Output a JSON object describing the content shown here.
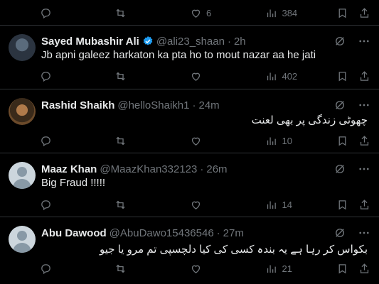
{
  "prev_tweet": {
    "likes": "6",
    "views": "384"
  },
  "tweets": [
    {
      "name": "Sayed Mubashir Ali",
      "handle": "@ali23_shaan",
      "sep": "·",
      "time": "2h",
      "text": "Jb apni galeez harkaton ka pta ho to mout nazar aa he jati",
      "views": "402",
      "verified": true
    },
    {
      "name": "Rashid Shaikh",
      "handle": "@helloShaikh1",
      "sep": "·",
      "time": "24m",
      "text": "چھوٹی زندگی پر بھی لعنت",
      "views": "10"
    },
    {
      "name": "Maaz Khan",
      "handle": "@MaazKhan332123",
      "sep": "·",
      "time": "26m",
      "text": "Big Fraud !!!!!",
      "views": "14"
    },
    {
      "name": "Abu Dawood",
      "handle": "@AbuDawo15436546",
      "sep": "·",
      "time": "27m",
      "text": "بکواس کر رہا ہے یہ بندہ کسی کی کیا دلچسپی تم مرو یا جیو",
      "views": "21"
    }
  ],
  "colors": {
    "background": "#000000",
    "text": "#e7e9ea",
    "muted": "#71767b",
    "verified": "#1d9bf0",
    "divider": "#2f3336"
  }
}
